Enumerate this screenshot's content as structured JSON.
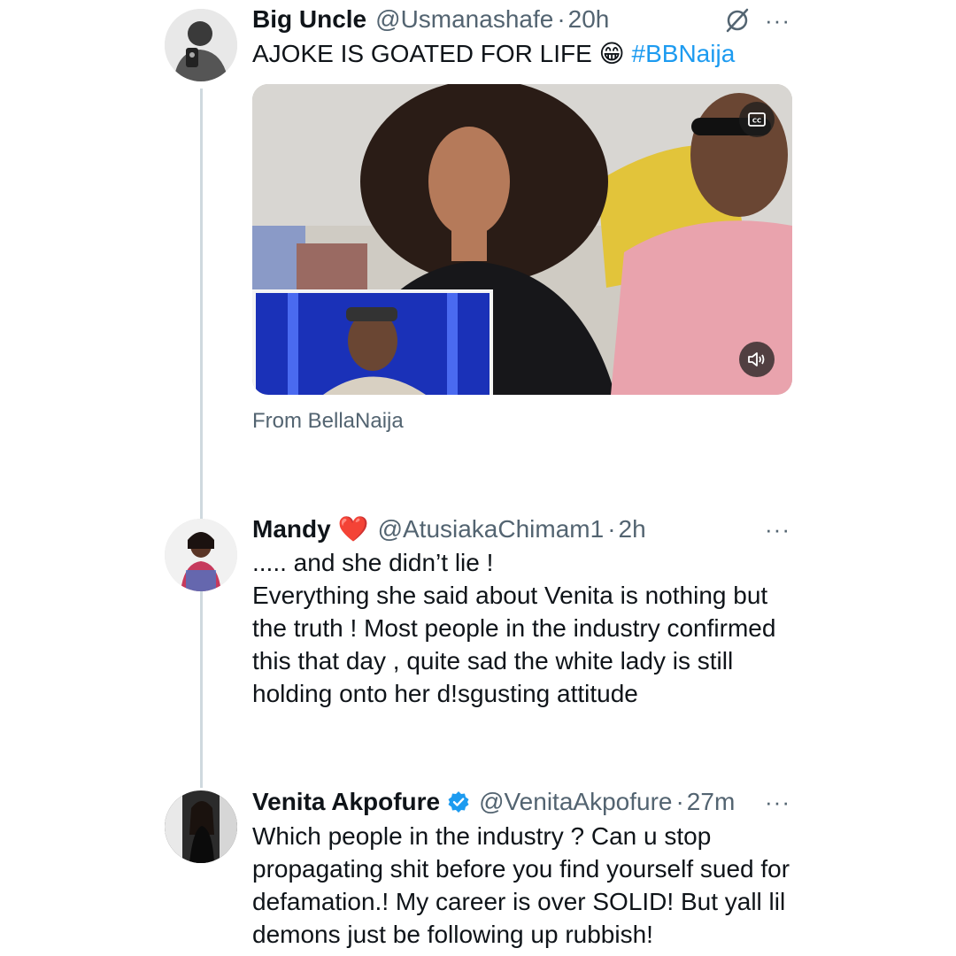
{
  "colors": {
    "link": "#1d9bf0",
    "secondary_text": "#536471",
    "thread_line": "#cfd9de",
    "heart": "#e0245e"
  },
  "tweets": [
    {
      "name": "Big Uncle",
      "handle": "@Usmanashafe",
      "dot": "·",
      "time": "20h",
      "more": "···",
      "text": "AJOKE IS GOATED FOR LIFE 😁",
      "hashtag": "#BBNaija",
      "media": {
        "cc_icon": "closed-captions-icon",
        "sound_icon": "speaker-icon",
        "source": "From BellaNaija"
      },
      "extra_icon": "grok-icon"
    },
    {
      "name": "Mandy",
      "name_emoji": "❤️",
      "handle": "@AtusiakaChimam1",
      "dot": "·",
      "time": "2h",
      "more": "···",
      "text": "..... and she didn’t lie !\nEverything she said about Venita is nothing but the truth ! Most people in the industry confirmed this that day , quite sad the white lady is still holding onto her d!sgusting attitude"
    },
    {
      "name": "Venita Akpofure",
      "verified_icon": "verified-badge-icon",
      "handle": "@VenitaAkpofure",
      "dot": "·",
      "time": "27m",
      "more": "···",
      "text": "Which people in the industry ? Can u stop propagating shit before you find yourself sued for defamation.! My career is over SOLID! But yall lil demons just be following up rubbish!"
    }
  ]
}
